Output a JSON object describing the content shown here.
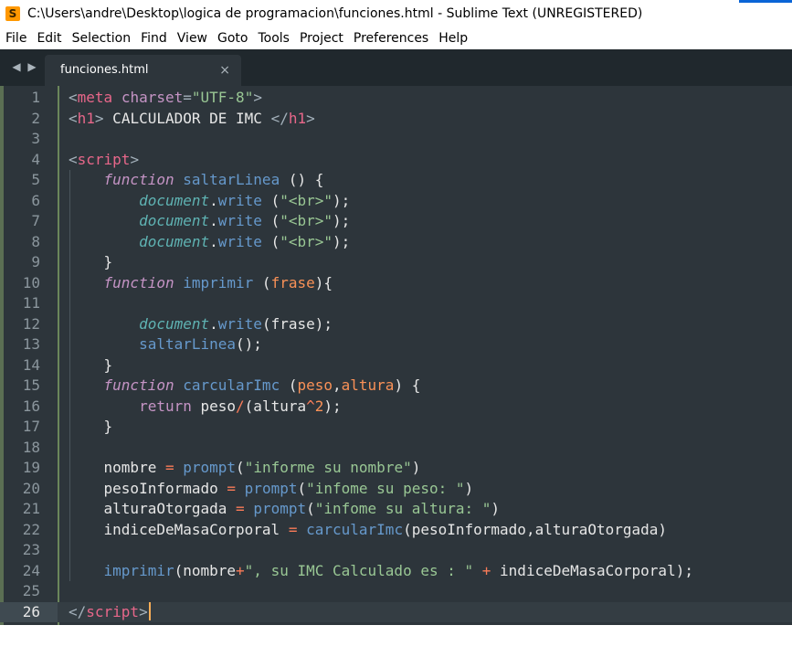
{
  "window": {
    "title": "C:\\Users\\andre\\Desktop\\logica de programacion\\funciones.html - Sublime Text (UNREGISTERED)",
    "logo_letter": "S"
  },
  "menu": [
    "File",
    "Edit",
    "Selection",
    "Find",
    "View",
    "Goto",
    "Tools",
    "Project",
    "Preferences",
    "Help"
  ],
  "tab": {
    "label": "funciones.html",
    "close_glyph": "×",
    "prev_glyph": "◀",
    "next_glyph": "▶"
  },
  "editor": {
    "current_line": 26,
    "colors": {
      "background": "#2d353b",
      "tag": "#e8678a",
      "string": "#99c794",
      "keyword": "#c594c5",
      "function": "#6699cc",
      "object": "#5fb3b3",
      "parameter": "#f99157"
    },
    "lines": [
      [
        [
          "t-punc",
          "<"
        ],
        [
          "t-tag",
          "meta"
        ],
        [
          "t-plain",
          " "
        ],
        [
          "t-attr",
          "charset"
        ],
        [
          "t-punc",
          "="
        ],
        [
          "t-str",
          "\"UTF-8\""
        ],
        [
          "t-punc",
          ">"
        ]
      ],
      [
        [
          "t-punc",
          "<"
        ],
        [
          "t-tag",
          "h1"
        ],
        [
          "t-punc",
          ">"
        ],
        [
          "t-plain",
          " CALCULADOR DE IMC "
        ],
        [
          "t-punc",
          "</"
        ],
        [
          "t-tag",
          "h1"
        ],
        [
          "t-punc",
          ">"
        ]
      ],
      [],
      [
        [
          "t-punc",
          "<"
        ],
        [
          "t-tag",
          "script"
        ],
        [
          "t-punc",
          ">"
        ]
      ],
      [
        [
          "t-plain",
          "    "
        ],
        [
          "t-kw",
          "function"
        ],
        [
          "t-plain",
          " "
        ],
        [
          "t-fn",
          "saltarLinea"
        ],
        [
          "t-plain",
          " () {"
        ]
      ],
      [
        [
          "t-plain",
          "        "
        ],
        [
          "t-obj",
          "document"
        ],
        [
          "t-plain",
          "."
        ],
        [
          "t-fn",
          "write"
        ],
        [
          "t-plain",
          " ("
        ],
        [
          "t-str",
          "\"<br>\""
        ],
        [
          "t-plain",
          ");"
        ]
      ],
      [
        [
          "t-plain",
          "        "
        ],
        [
          "t-obj",
          "document"
        ],
        [
          "t-plain",
          "."
        ],
        [
          "t-fn",
          "write"
        ],
        [
          "t-plain",
          " ("
        ],
        [
          "t-str",
          "\"<br>\""
        ],
        [
          "t-plain",
          ");"
        ]
      ],
      [
        [
          "t-plain",
          "        "
        ],
        [
          "t-obj",
          "document"
        ],
        [
          "t-plain",
          "."
        ],
        [
          "t-fn",
          "write"
        ],
        [
          "t-plain",
          " ("
        ],
        [
          "t-str",
          "\"<br>\""
        ],
        [
          "t-plain",
          ");"
        ]
      ],
      [
        [
          "t-plain",
          "    }"
        ]
      ],
      [
        [
          "t-plain",
          "    "
        ],
        [
          "t-kw",
          "function"
        ],
        [
          "t-plain",
          " "
        ],
        [
          "t-fn",
          "imprimir"
        ],
        [
          "t-plain",
          " ("
        ],
        [
          "t-param",
          "frase"
        ],
        [
          "t-plain",
          "){"
        ]
      ],
      [],
      [
        [
          "t-plain",
          "        "
        ],
        [
          "t-obj",
          "document"
        ],
        [
          "t-plain",
          "."
        ],
        [
          "t-fn",
          "write"
        ],
        [
          "t-plain",
          "(frase);"
        ]
      ],
      [
        [
          "t-plain",
          "        "
        ],
        [
          "t-fn",
          "saltarLinea"
        ],
        [
          "t-plain",
          "();"
        ]
      ],
      [
        [
          "t-plain",
          "    }"
        ]
      ],
      [
        [
          "t-plain",
          "    "
        ],
        [
          "t-kw",
          "function"
        ],
        [
          "t-plain",
          " "
        ],
        [
          "t-fn",
          "carcularImc"
        ],
        [
          "t-plain",
          " ("
        ],
        [
          "t-param",
          "peso"
        ],
        [
          "t-plain",
          ","
        ],
        [
          "t-param",
          "altura"
        ],
        [
          "t-plain",
          ") {"
        ]
      ],
      [
        [
          "t-plain",
          "        "
        ],
        [
          "t-attr",
          "return"
        ],
        [
          "t-plain",
          " peso"
        ],
        [
          "t-op",
          "/"
        ],
        [
          "t-plain",
          "(altura"
        ],
        [
          "t-op",
          "^"
        ],
        [
          "t-num",
          "2"
        ],
        [
          "t-plain",
          ");"
        ]
      ],
      [
        [
          "t-plain",
          "    }"
        ]
      ],
      [],
      [
        [
          "t-plain",
          "    nombre "
        ],
        [
          "t-op",
          "="
        ],
        [
          "t-plain",
          " "
        ],
        [
          "t-fn",
          "prompt"
        ],
        [
          "t-plain",
          "("
        ],
        [
          "t-str",
          "\"informe su nombre\""
        ],
        [
          "t-plain",
          ")"
        ]
      ],
      [
        [
          "t-plain",
          "    pesoInformado "
        ],
        [
          "t-op",
          "="
        ],
        [
          "t-plain",
          " "
        ],
        [
          "t-fn",
          "prompt"
        ],
        [
          "t-plain",
          "("
        ],
        [
          "t-str",
          "\"infome su peso: \""
        ],
        [
          "t-plain",
          ")"
        ]
      ],
      [
        [
          "t-plain",
          "    alturaOtorgada "
        ],
        [
          "t-op",
          "="
        ],
        [
          "t-plain",
          " "
        ],
        [
          "t-fn",
          "prompt"
        ],
        [
          "t-plain",
          "("
        ],
        [
          "t-str",
          "\"infome su altura: \""
        ],
        [
          "t-plain",
          ")"
        ]
      ],
      [
        [
          "t-plain",
          "    indiceDeMasaCorporal "
        ],
        [
          "t-op",
          "="
        ],
        [
          "t-plain",
          " "
        ],
        [
          "t-fn",
          "carcularImc"
        ],
        [
          "t-plain",
          "(pesoInformado,alturaOtorgada)"
        ]
      ],
      [],
      [
        [
          "t-plain",
          "    "
        ],
        [
          "t-fn",
          "imprimir"
        ],
        [
          "t-plain",
          "(nombre"
        ],
        [
          "t-op",
          "+"
        ],
        [
          "t-str",
          "\", su IMC Calculado es : \""
        ],
        [
          "t-plain",
          " "
        ],
        [
          "t-op",
          "+"
        ],
        [
          "t-plain",
          " indiceDeMasaCorporal);"
        ]
      ],
      [],
      [
        [
          "t-punc",
          "</"
        ],
        [
          "t-tag",
          "script"
        ],
        [
          "t-punc",
          ">"
        ]
      ]
    ]
  }
}
